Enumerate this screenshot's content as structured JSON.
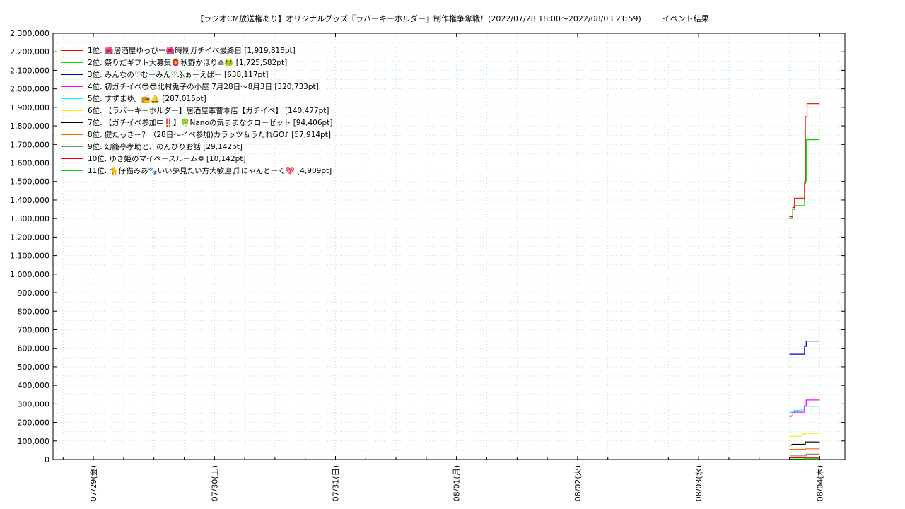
{
  "title": "【ラジオCM放送権あり】オリジナルグッズ『ラバーキーホルダー』制作権争奪戦！(2022/07/28 18:00～2022/08/03 21:59)",
  "subtitle": "イベント結果",
  "chart_data": {
    "type": "line",
    "title": "【ラジオCM放送権あり】オリジナルグッズ『ラバーキーホルダー』制作権争奪戦！(2022/07/28 18:00～2022/08/03 21:59)",
    "ylim": [
      0,
      2300000
    ],
    "xlim": [
      "2022-07-28 16:00",
      "2022-08-04 05:00"
    ],
    "grid": true,
    "legend_position": "top-left",
    "x_ticks": [
      {
        "x": "2022-07-29 00:00",
        "label": "07/29(金)"
      },
      {
        "x": "2022-07-30 00:00",
        "label": "07/30(土)"
      },
      {
        "x": "2022-07-31 00:00",
        "label": "07/31(日)"
      },
      {
        "x": "2022-08-01 00:00",
        "label": "08/01(月)"
      },
      {
        "x": "2022-08-02 00:00",
        "label": "08/02(火)"
      },
      {
        "x": "2022-08-03 00:00",
        "label": "08/03(水)"
      },
      {
        "x": "2022-08-04 00:00",
        "label": "08/04(木)"
      }
    ],
    "y_ticks": [
      "0",
      "100,000",
      "200,000",
      "300,000",
      "400,000",
      "500,000",
      "600,000",
      "700,000",
      "800,000",
      "900,000",
      "1,000,000",
      "1,100,000",
      "1,200,000",
      "1,300,000",
      "1,400,000",
      "1,500,000",
      "1,600,000",
      "1,700,000",
      "1,800,000",
      "1,900,000",
      "2,000,000",
      "2,100,000",
      "2,200,000",
      "2,300,000"
    ],
    "series": [
      {
        "name": "1位. 🌺居酒屋ゆっぴー🌺時制ガチイベ最終日 [1,919,815pt]",
        "color": "#ff0000",
        "x": [
          "2022-08-03 18:00",
          "2022-08-03 18:20",
          "2022-08-03 18:40",
          "2022-08-03 19:00",
          "2022-08-03 20:00",
          "2022-08-03 20:40",
          "2022-08-03 21:00",
          "2022-08-03 21:10",
          "2022-08-03 21:30",
          "2022-08-03 22:00",
          "2022-08-04 00:00"
        ],
        "values": [
          1310000,
          1310000,
          1360000,
          1410000,
          1410000,
          1410000,
          1490000,
          1850000,
          1919815,
          1919815,
          1919815
        ]
      },
      {
        "name": "2位. 祭りだギフト大募集🏮秋野かほり♎🐸 [1,725,582pt]",
        "color": "#00dd00",
        "x": [
          "2022-08-03 18:00",
          "2022-08-03 18:20",
          "2022-08-03 18:40",
          "2022-08-03 19:00",
          "2022-08-03 20:00",
          "2022-08-03 20:40",
          "2022-08-03 21:00",
          "2022-08-03 21:20",
          "2022-08-03 22:00",
          "2022-08-04 00:00"
        ],
        "values": [
          1300000,
          1300000,
          1350000,
          1370000,
          1370000,
          1370000,
          1500000,
          1725582,
          1725582,
          1725582
        ]
      },
      {
        "name": "3位. みんなの♡むーみん♡ふぁーえばー [638,117pt]",
        "color": "#0000cc",
        "x": [
          "2022-08-03 18:00",
          "2022-08-03 20:40",
          "2022-08-03 21:00",
          "2022-08-03 21:20",
          "2022-08-04 00:00"
        ],
        "values": [
          568000,
          568000,
          610000,
          638117,
          638117
        ]
      },
      {
        "name": "4位. 初ガチイベ😎😎北村兎子の小屋 7月28日〜8月3日 [320,733pt]",
        "color": "#ff00ff",
        "x": [
          "2022-08-03 18:00",
          "2022-08-03 18:20",
          "2022-08-03 18:40",
          "2022-08-03 20:40",
          "2022-08-03 21:00",
          "2022-08-03 21:20",
          "2022-08-04 00:00"
        ],
        "values": [
          232000,
          235000,
          255000,
          255000,
          290000,
          320733,
          320733
        ]
      },
      {
        "name": "5位. すずまゆ。📻🔔 [287,015pt]",
        "color": "#00ffff",
        "x": [
          "2022-08-03 18:00",
          "2022-08-03 18:40",
          "2022-08-03 19:00",
          "2022-08-03 20:30",
          "2022-08-03 21:00",
          "2022-08-04 00:00"
        ],
        "values": [
          255000,
          255000,
          265000,
          268000,
          287015,
          287015
        ]
      },
      {
        "name": "6位. 【ラバーキーホルダー】居酒屋軍曹本店【ガチイベ】 [140,477pt]",
        "color": "#eeee00",
        "x": [
          "2022-08-03 18:00",
          "2022-08-03 19:30",
          "2022-08-03 20:30",
          "2022-08-03 21:00",
          "2022-08-04 00:00"
        ],
        "values": [
          125000,
          125000,
          135000,
          140477,
          140477
        ]
      },
      {
        "name": "7位. 【ガチイベ参加中‼️】🍀Nanoの気ままなクローゼット [94,406pt]",
        "color": "#000000",
        "x": [
          "2022-08-03 18:00",
          "2022-08-03 18:30",
          "2022-08-03 20:40",
          "2022-08-03 21:10",
          "2022-08-04 00:00"
        ],
        "values": [
          78000,
          82000,
          82000,
          94406,
          94406
        ]
      },
      {
        "name": "8位. 健たっきー？（28日〜イベ参加)カラッツ＆うたれGO♪ [57,914pt]",
        "color": "#ff6600",
        "x": [
          "2022-08-03 18:00",
          "2022-08-03 20:40",
          "2022-08-03 21:10",
          "2022-08-04 00:00"
        ],
        "values": [
          55000,
          55000,
          57914,
          57914
        ]
      },
      {
        "name": "9位. 幻籠亭孝助と、のんびりお話 [29,142pt]",
        "color": "#888888",
        "x": [
          "2022-08-03 18:00",
          "2022-08-03 21:00",
          "2022-08-03 21:20",
          "2022-08-04 00:00"
        ],
        "values": [
          20000,
          20000,
          29142,
          29142
        ]
      },
      {
        "name": "10位. ゆき姫のマイペースルーム❁ [10,142pt]",
        "color": "#ff0000",
        "x": [
          "2022-08-03 18:00",
          "2022-08-03 21:00",
          "2022-08-04 00:00"
        ],
        "values": [
          10000,
          10142,
          10142
        ]
      },
      {
        "name": "11位. 🐈仔猫みあ🐾いい夢見たい方大歓迎🎵にゃんとーく💖 [4,909pt]",
        "color": "#00dd00",
        "x": [
          "2022-08-03 18:00",
          "2022-08-03 21:00",
          "2022-08-04 00:00"
        ],
        "values": [
          3000,
          4909,
          4909
        ]
      }
    ]
  }
}
